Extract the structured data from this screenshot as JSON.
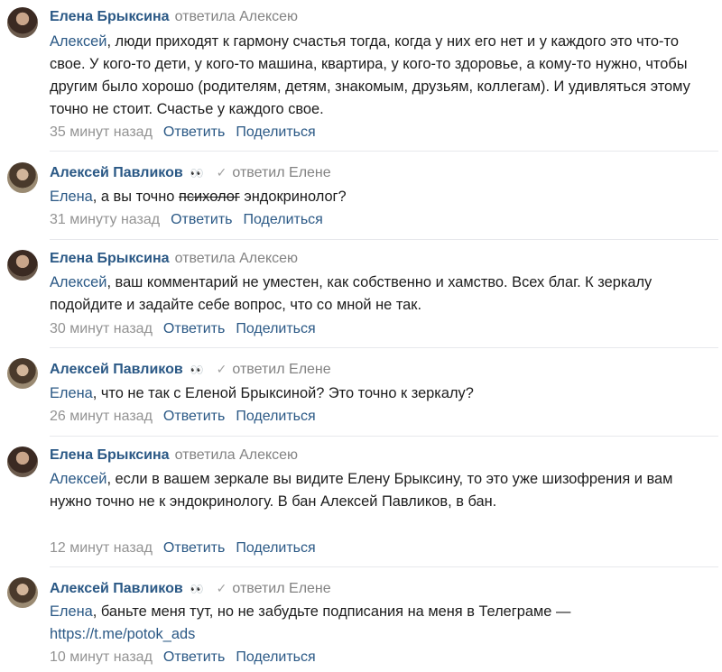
{
  "reply_label": "Ответить",
  "share_label": "Поделиться",
  "comments": [
    {
      "author": "Елена Бryксина",
      "replied": "ответила Алексею",
      "addressee": "Алексей",
      "text": ", люди приходят к гармону счастья тогда, когда у них его нет и у каждого это что-то свое. У кого-то дети, у кого-то машина, квартира, у кого-то здоровье, а кому-то нужно, чтобы другим было хорошо (родителям, детям, знакомым, друзьям, коллегам). И удивляться этому точно не стоит. Счастье у каждого свое.",
      "time": "35 минут назад"
    },
    {
      "author": "Алексей Павликов",
      "badge": "👀",
      "replied": "ответил Елене",
      "addressee": "Елена",
      "text_before": ", а вы точно ",
      "strike": "психолог",
      "text_after": " эндокринолог?",
      "time": "31 минуту назад"
    },
    {
      "author": "Елена Брыксина",
      "replied": "ответила Алексею",
      "addressee": "Алексей",
      "text": ", ваш комментарий не уместен, как собственно и хамство. Всех благ. К зеркалу подойдите и задайте себе вопрос, что со мной не так.",
      "time": "30 минут назад"
    },
    {
      "author": "Алексей Павликов",
      "badge": "👀",
      "replied": "ответил Елене",
      "addressee": "Елена",
      "text": ", что не так с Еленой Брыксиной? Это точно к зеркалу?",
      "time": "26 минут назад"
    },
    {
      "author": "Елена Брыксина",
      "replied": "ответила Алексею",
      "addressee": "Алексей",
      "text": ", если в вашем зеркале вы видите Елену Брыксину, то это уже шизофрения и вам нужно точно не к эндокринологу. В бан Алексей Павликов, в бан.",
      "time": "12 минут назад"
    },
    {
      "author": "Алексей Павликов",
      "badge": "👀",
      "replied": "ответил Елене",
      "addressee": "Елена",
      "text": ", баньте меня тут, но не забудьте подписания на меня в Телеграме —",
      "link": "https://t.me/potok_ads",
      "time": "10 минут назад"
    }
  ]
}
